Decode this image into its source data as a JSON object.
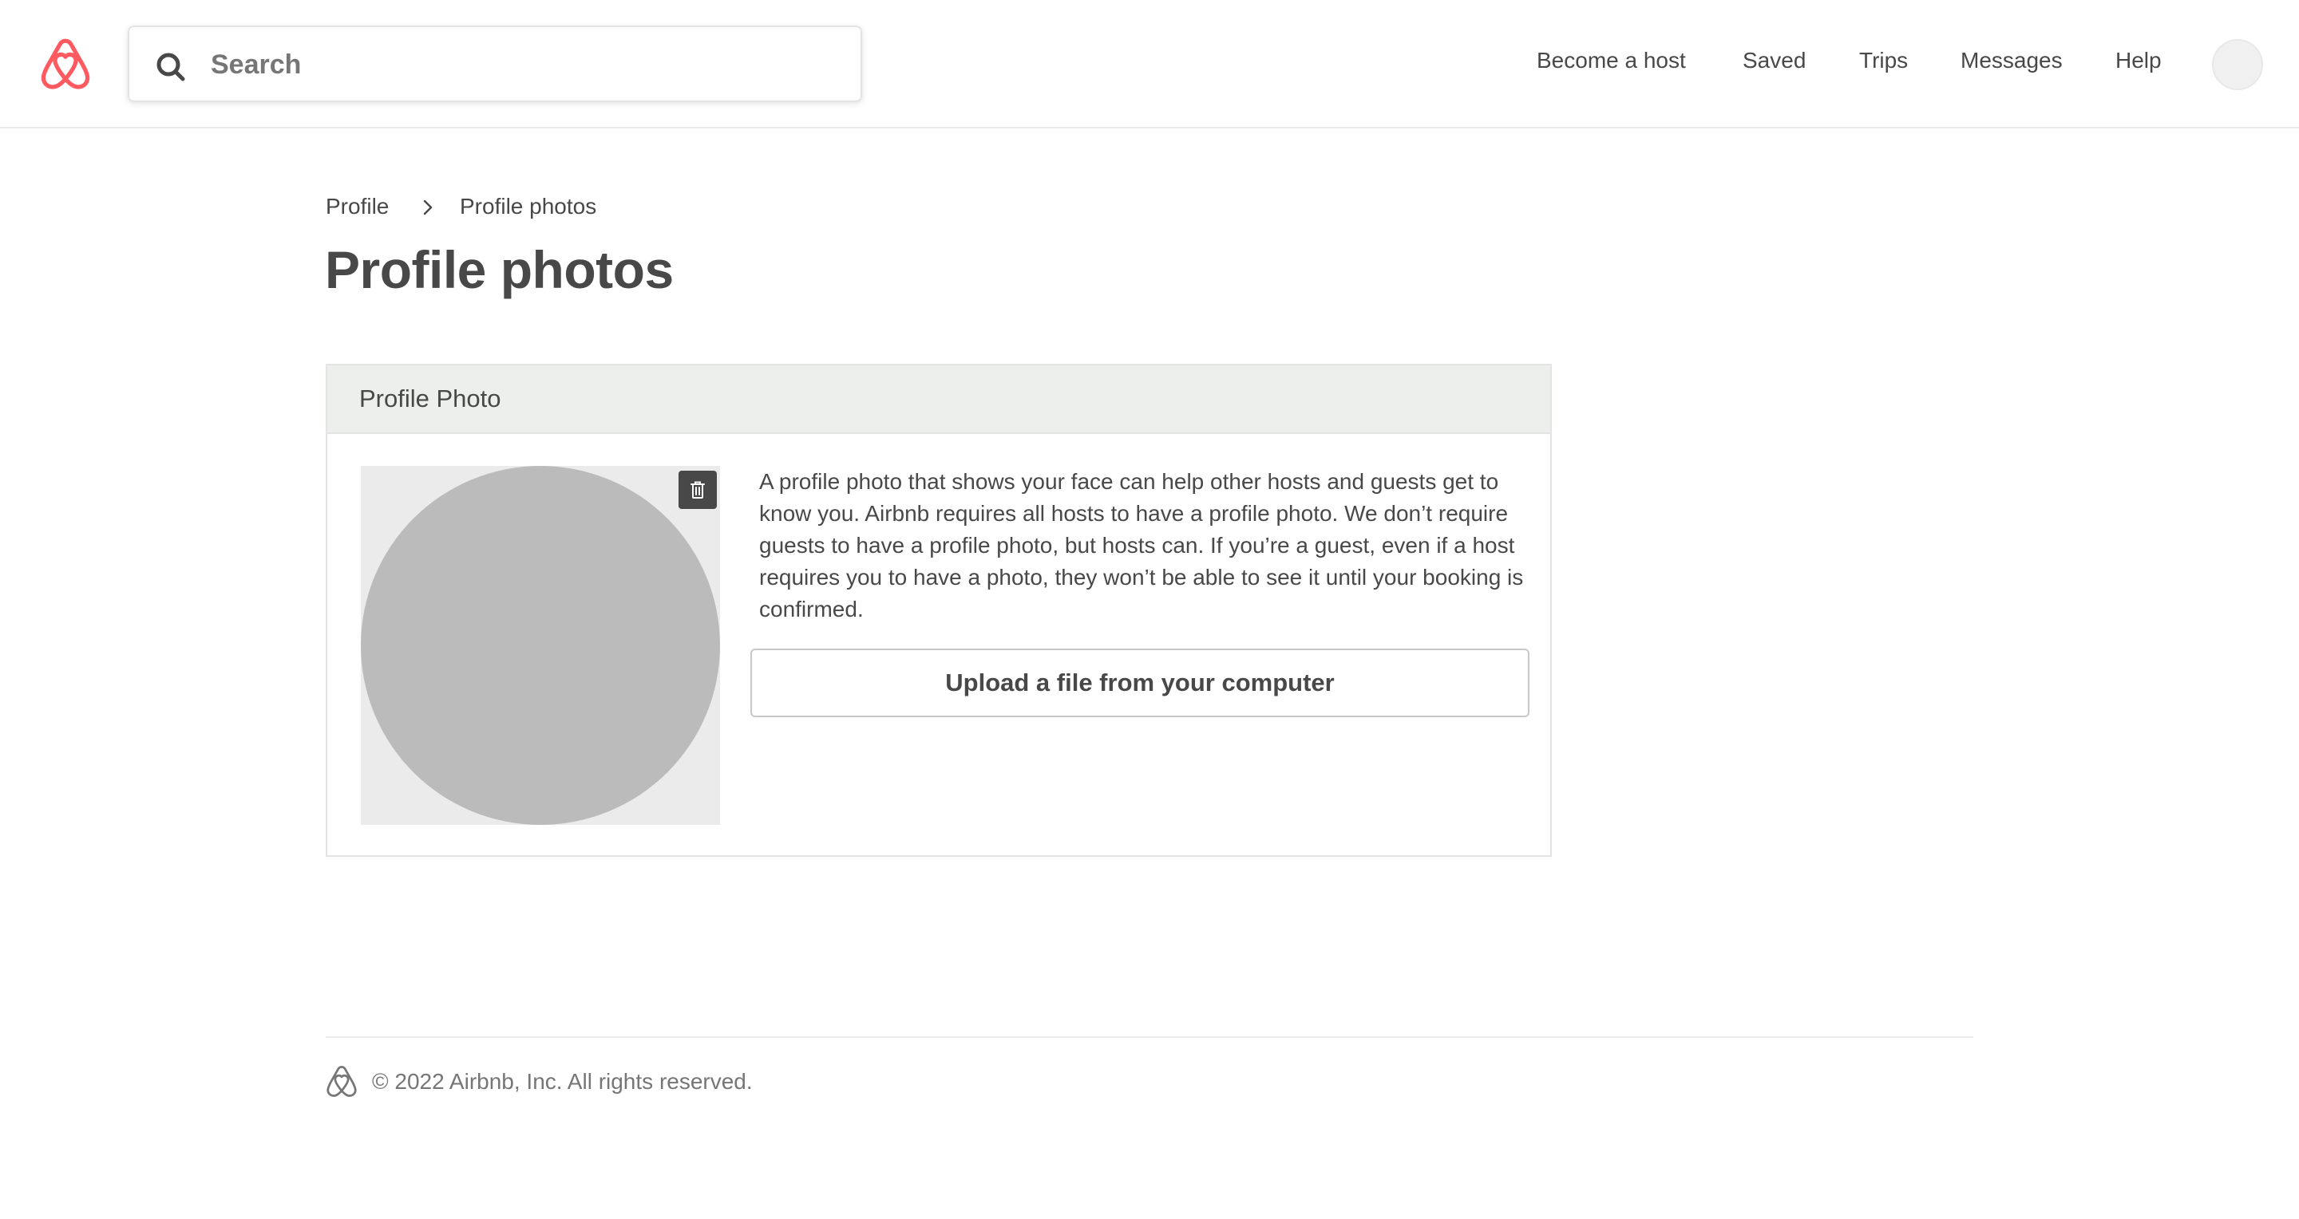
{
  "colors": {
    "brand": "#ff5a5f",
    "text": "#484848",
    "muted": "#767676",
    "panel_header_bg": "#edefed",
    "placeholder_photo": "#bbbbbb"
  },
  "header": {
    "logo_icon": "airbnb-belo-icon",
    "search": {
      "icon": "search-icon",
      "placeholder": "Search",
      "value": ""
    },
    "nav": {
      "become_host": "Become a host",
      "saved": "Saved",
      "trips": "Trips",
      "messages": "Messages",
      "help": "Help"
    },
    "avatar_icon": "user-avatar"
  },
  "breadcrumb": {
    "profile": "Profile",
    "separator_icon": "chevron-right-icon",
    "current": "Profile photos"
  },
  "page": {
    "title": "Profile photos"
  },
  "profile_photo_panel": {
    "heading": "Profile Photo",
    "delete_icon": "trash-icon",
    "description": "A profile photo that shows your face can help other hosts and guests get to know you. Airbnb requires all hosts to have a profile photo. We don’t require guests to have a profile photo, but hosts can. If you’re a guest, even if a host requires you to have a photo, they won’t be able to see it until your booking is confirmed.",
    "upload_label": "Upload a file from your computer"
  },
  "footer": {
    "logo_icon": "airbnb-belo-icon",
    "copyright": "© 2022 Airbnb, Inc. All rights reserved."
  }
}
